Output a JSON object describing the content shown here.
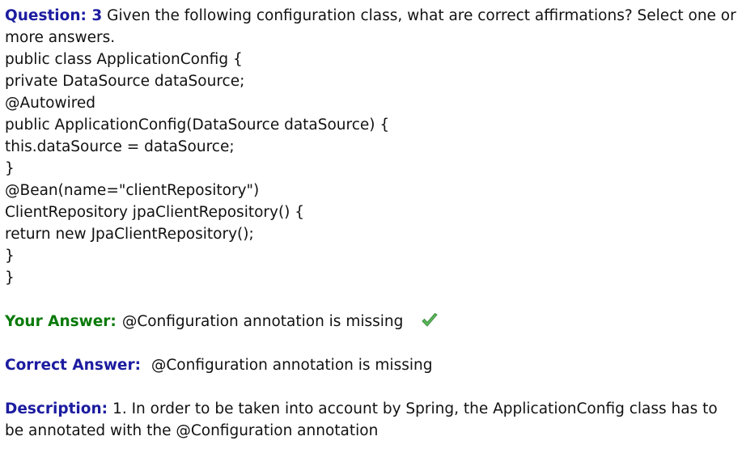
{
  "question": {
    "label": "Question:",
    "number": "3",
    "text": "Given the following configuration class, what are correct affirmations? Select one or more answers."
  },
  "code_lines": [
    "public class ApplicationConfig {",
    "private DataSource dataSource;",
    "@Autowired",
    "public ApplicationConfig(DataSource dataSource) {",
    "this.dataSource = dataSource;",
    "}",
    "@Bean(name=\"clientRepository\")",
    "ClientRepository jpaClientRepository() {",
    "return new JpaClientRepository();",
    "}",
    "}"
  ],
  "your_answer": {
    "label": "Your Answer:",
    "text": "@Configuration annotation is missing",
    "icon": "checkmark-icon",
    "icon_color": "#5cb85c"
  },
  "correct_answer": {
    "label": "Correct Answer:",
    "text": "@Configuration annotation is missing"
  },
  "description": {
    "label": "Description:",
    "text": "1. In order to be taken into account by Spring, the ApplicationConfig class has to be annotated with the @Configuration annotation"
  },
  "colors": {
    "label_blue": "#1c1ca0",
    "label_green": "#0a7a0a",
    "text": "#111111"
  }
}
